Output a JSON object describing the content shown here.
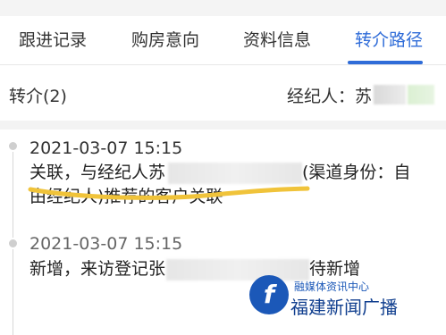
{
  "tabs": [
    {
      "label": "跟进记录",
      "active": false
    },
    {
      "label": "购房意向",
      "active": false
    },
    {
      "label": "资料信息",
      "active": false
    },
    {
      "label": "转介路径",
      "active": true
    }
  ],
  "header": {
    "referral_count": "转介(2)",
    "agent_label": "经纪人：苏"
  },
  "timeline": [
    {
      "timestamp": "2021-03-07 15:15",
      "line1_prefix": "关联，与经纪人苏",
      "line1_suffix": "(渠道身份：自",
      "line2": "由经纪人)推荐的客户关联"
    },
    {
      "timestamp": "2021-03-07 15:15",
      "line1_prefix": "新增，来访登记张",
      "line1_suffix": "待新增"
    }
  ],
  "watermark": {
    "top_text": "融媒体资讯中心",
    "main_text": "福建新闻广播"
  },
  "colors": {
    "accent": "#2f6cd8",
    "highlight": "#f0c33a"
  }
}
